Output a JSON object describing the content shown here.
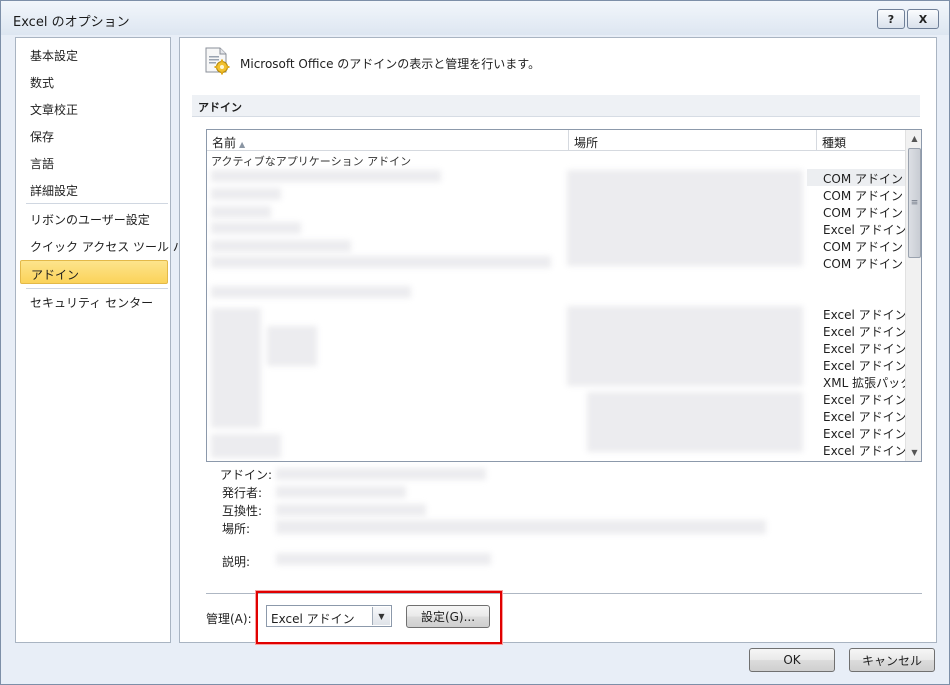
{
  "window": {
    "title": "Excel のオプション",
    "help_label": "?",
    "close_label": "X"
  },
  "nav": {
    "items": [
      {
        "label": "基本設定"
      },
      {
        "label": "数式"
      },
      {
        "label": "文章校正"
      },
      {
        "label": "保存"
      },
      {
        "label": "言語"
      },
      {
        "label": "詳細設定"
      },
      {
        "label": "リボンのユーザー設定"
      },
      {
        "label": "クイック アクセス ツール バー"
      },
      {
        "label": "アドイン"
      },
      {
        "label": "セキュリティ センター"
      }
    ],
    "selected": "アドイン"
  },
  "header": {
    "icon": "addin-gear-icon",
    "text": "Microsoft Office のアドインの表示と管理を行います。"
  },
  "section": {
    "title": "アドイン"
  },
  "listview": {
    "columns": [
      "名前",
      "場所",
      "種類"
    ],
    "sort_indicator": "▲",
    "group_active": "アクティブなアプリケーション アドイン",
    "rows": [
      {
        "type": "COM アドイン"
      },
      {
        "type": "COM アドイン"
      },
      {
        "type": "COM アドイン"
      },
      {
        "type": "Excel アドイン"
      },
      {
        "type": "COM アドイン"
      },
      {
        "type": "COM アドイン"
      },
      {
        "type": "Excel アドイン"
      },
      {
        "type": "Excel アドイン"
      },
      {
        "type": "Excel アドイン"
      },
      {
        "type": "Excel アドイン"
      },
      {
        "type": "XML 拡張パック"
      },
      {
        "type": "Excel アドイン"
      },
      {
        "type": "Excel アドイン"
      },
      {
        "type": "Excel アドイン"
      },
      {
        "type": "Excel アドイン"
      }
    ],
    "scroll_up": "▲",
    "scroll_down": "▼",
    "scroll_grip": "≡"
  },
  "details": {
    "addin_label": "アドイン:",
    "publisher_label": "発行者:",
    "compat_label": "互換性:",
    "location_label": "場所:",
    "description_label": "説明:"
  },
  "manage": {
    "label": "管理(A):",
    "selected_value": "Excel アドイン",
    "dropdown_arrow": "▼",
    "go_button": "設定(G)..."
  },
  "buttons": {
    "ok": "OK",
    "cancel": "キャンセル"
  }
}
